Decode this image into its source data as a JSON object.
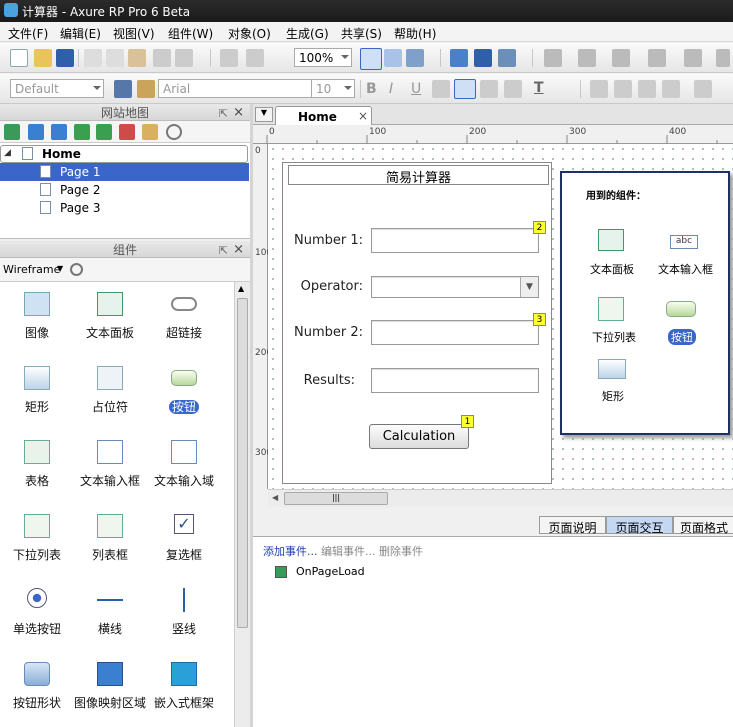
{
  "window": {
    "title": "计算器 - Axure RP Pro 6 Beta"
  },
  "menu": [
    "文件(F)",
    "编辑(E)",
    "视图(V)",
    "组件(W)",
    "对象(O)",
    "生成(G)",
    "共享(S)",
    "帮助(H)"
  ],
  "toolbar": {
    "zoom": "100%",
    "style_combo": "Default",
    "font_combo": "Arial",
    "font_size": "10",
    "bold": "B",
    "italic": "I",
    "underline": "U",
    "text_color": "T"
  },
  "sitemap": {
    "title": "网站地图",
    "root": "Home",
    "pages": [
      "Page 1",
      "Page 2",
      "Page 3"
    ],
    "selected": "Page 1"
  },
  "widgets_panel": {
    "title": "组件",
    "library": "Wireframe",
    "items": [
      "图像",
      "文本面板",
      "超链接",
      "矩形",
      "占位符",
      "按钮",
      "表格",
      "文本输入框",
      "文本输入域",
      "下拉列表",
      "列表框",
      "复选框",
      "单选按钮",
      "横线",
      "竖线",
      "按钮形状",
      "图像映射区域",
      "嵌入式框架"
    ]
  },
  "editor": {
    "tab": "Home",
    "ruler_top": [
      "0",
      "100",
      "200",
      "300",
      "400"
    ],
    "ruler_left": [
      "0",
      "100",
      "200",
      "300"
    ]
  },
  "calculator": {
    "title": "简易计算器",
    "label_number1": "Number 1:",
    "label_operator": "Operator:",
    "label_number2": "Number 2:",
    "label_results": "Results:",
    "button": "Calculation",
    "badge1": "2",
    "badge2": "3",
    "badge3": "1"
  },
  "used_widgets": {
    "title": "用到的组件：",
    "items": [
      "文本面板",
      "文本输入框",
      "下拉列表",
      "按钮",
      "矩形"
    ]
  },
  "bottom_panel": {
    "tabs": [
      "页面说明",
      "页面交互",
      "页面格式"
    ],
    "active_tab": "页面交互",
    "add_event": "添加事件...",
    "edit_event": "编辑事件...",
    "delete_event": "删除事件",
    "event": "OnPageLoad"
  },
  "colors": {
    "selection": "#3a66c9",
    "accent_blue": "#1f3b7a",
    "badge": "#ffff33"
  }
}
